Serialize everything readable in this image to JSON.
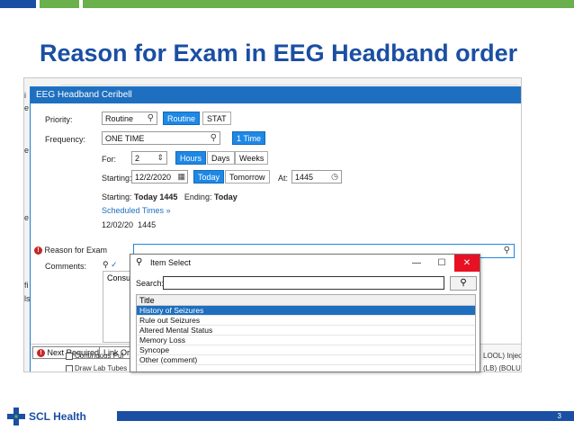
{
  "slide": {
    "title": "Reason for Exam in EEG Headband order",
    "page_number": "3",
    "logo_text": "SCL Health",
    "colors": {
      "brand_blue": "#1a4fa3",
      "brand_green": "#6ab04c",
      "accent_blue": "#1e88e5",
      "error_red": "#c62828"
    }
  },
  "order": {
    "title": "EEG Headband Ceribell",
    "priority_label": "Priority:",
    "priority_value": "Routine",
    "priority_options": [
      "Routine",
      "STAT"
    ],
    "frequency_label": "Frequency:",
    "frequency_value": "ONE TIME",
    "frequency_option": "1 Time",
    "for_label": "For:",
    "for_value": "2",
    "duration_options": [
      "Hours",
      "Days",
      "Weeks"
    ],
    "starting_label": "Starting:",
    "starting_value": "12/2/2020",
    "starting_options": [
      "Today",
      "Tomorrow"
    ],
    "at_label": "At:",
    "at_value": "1445",
    "summary_starting_label": "Starting:",
    "summary_starting_value": "Today 1445",
    "summary_ending_label": "Ending:",
    "summary_ending_value": "Today",
    "scheduled_times_link": "Scheduled Times",
    "scheduled_date": "12/02/20",
    "scheduled_time": "1445",
    "reason_label": "Reason for Exam",
    "comments_label": "Comments:",
    "comments_value": "Consul",
    "next_required_label": "Next Required",
    "link_order_label": "Link Ord",
    "under_row_1": "Continuous Pul",
    "under_row_2": "Draw Lab Tubes",
    "right_fragment_1": "LOOL) Inject",
    "right_fragment_2": "(LB) (BOLUS"
  },
  "item_select": {
    "title": "Item Select",
    "search_label": "Search:",
    "search_value": "",
    "column_header": "Title",
    "items": [
      {
        "label": "History of Seizures",
        "selected": true
      },
      {
        "label": "Rule out Seizures",
        "selected": false
      },
      {
        "label": "Altered Mental Status",
        "selected": false
      },
      {
        "label": "Memory Loss",
        "selected": false
      },
      {
        "label": "Syncope",
        "selected": false
      },
      {
        "label": "Other (comment)",
        "selected": false
      }
    ]
  }
}
